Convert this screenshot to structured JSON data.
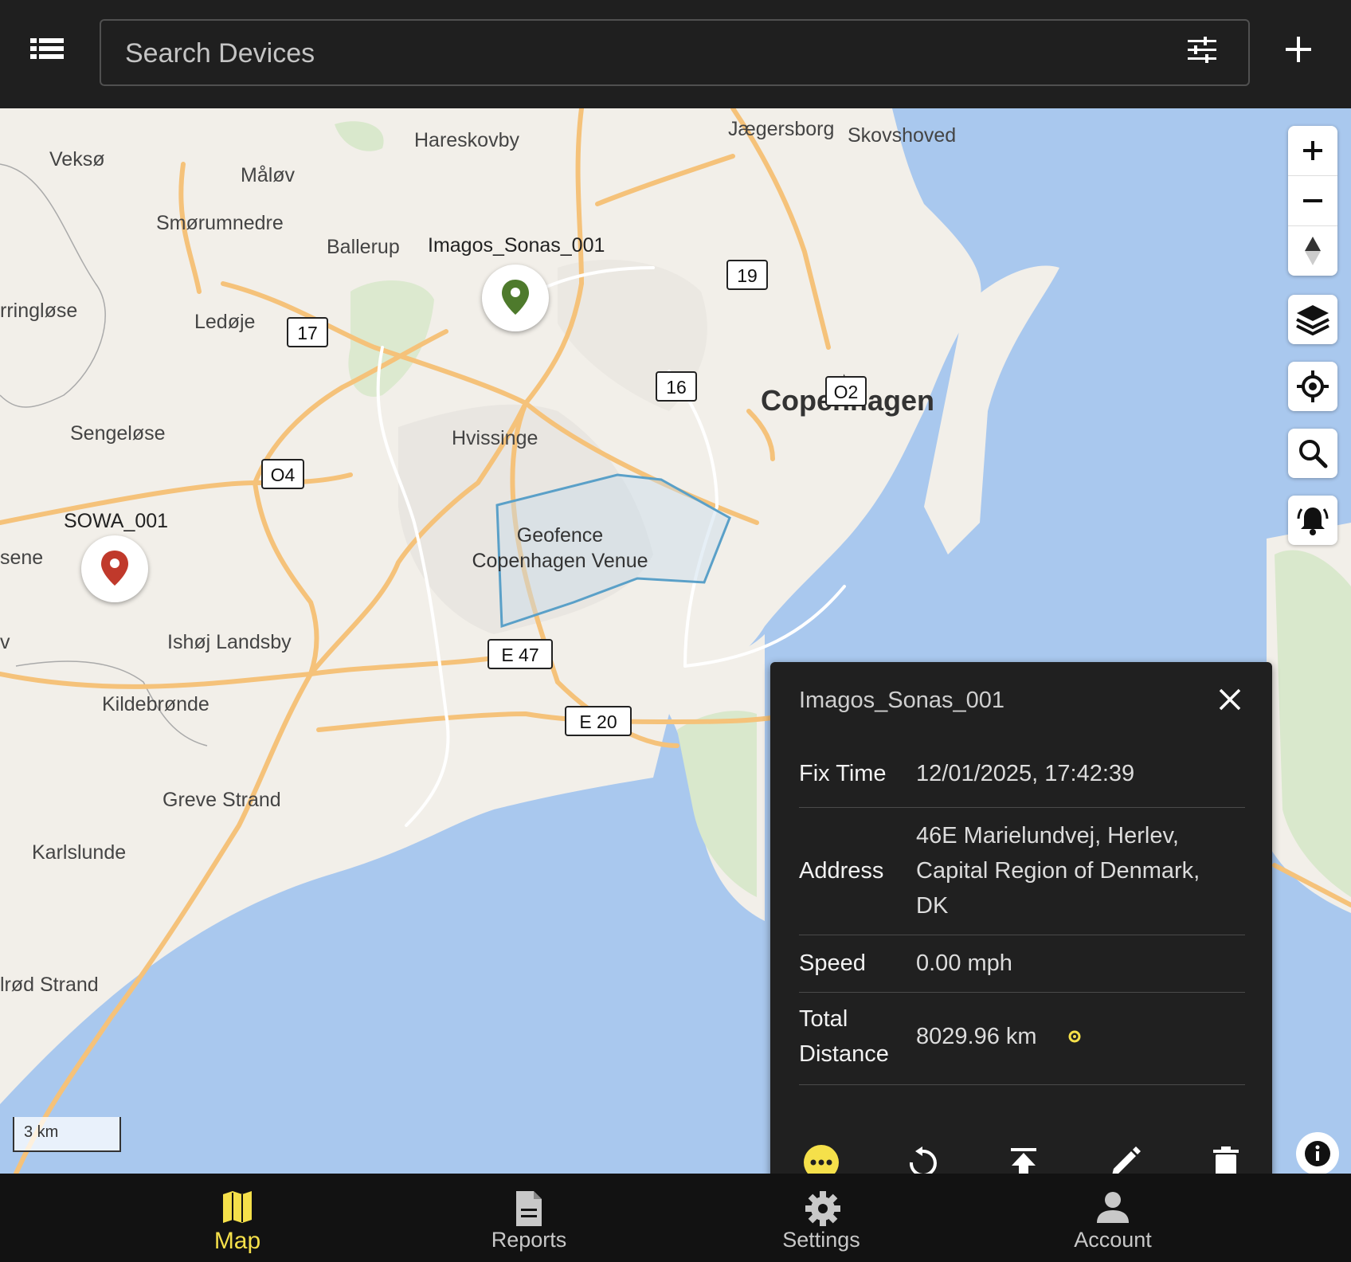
{
  "topbar": {
    "search_placeholder": "Search Devices",
    "menu_icon": "list-icon",
    "filter_icon": "tune-icon",
    "add_icon": "plus-icon"
  },
  "map": {
    "places": [
      "Veksø",
      "Måløv",
      "Hareskovby",
      "Jægersborg",
      "Skovshoved",
      "Smørumnedre",
      "Ballerup",
      "rringløse",
      "Ledøje",
      "Copenhagen",
      "Hvissinge",
      "Sengeløse",
      "sene",
      "Ishøj Landsby",
      "Kildebrønde",
      "Greve Strand",
      "Karlslunde",
      "lrød Strand",
      "v"
    ],
    "road_shields": [
      "19",
      "16",
      "O2",
      "17",
      "O4",
      "E 47",
      "E 20"
    ],
    "devices": [
      {
        "name": "Imagos_Sonas_001",
        "status_color": "#4e7a2c"
      },
      {
        "name": "SOWA_001",
        "status_color": "#c0392b"
      }
    ],
    "geofence": {
      "line1": "Geofence",
      "line2": "Copenhagen Venue",
      "color": "#5aa0c8"
    },
    "scale": "3 km",
    "colors": {
      "land": "#f2efe9",
      "water": "#a9c8ee",
      "road": "#f5c27a",
      "park": "#d9e8cc"
    }
  },
  "controls": [
    "zoom-in-icon",
    "zoom-out-icon",
    "compass-icon",
    "layers-icon",
    "my-location-icon",
    "search-icon",
    "alarm-bell-icon"
  ],
  "popup": {
    "title": "Imagos_Sonas_001",
    "rows": [
      {
        "label": "Fix Time",
        "value": "12/01/2025, 17:42:39"
      },
      {
        "label": "Address",
        "value_lines": [
          "46E Marielundvej, Herlev,",
          "Capital Region of Denmark,",
          "DK"
        ]
      },
      {
        "label": "Speed",
        "value": "0.00 mph"
      },
      {
        "label_lines": [
          "Total",
          "Distance"
        ],
        "value": "8029.96 km"
      }
    ],
    "accent": "#f5e04a"
  },
  "nav": [
    {
      "label": "Map",
      "icon": "map-icon",
      "active": true
    },
    {
      "label": "Reports",
      "icon": "document-icon",
      "active": false
    },
    {
      "label": "Settings",
      "icon": "gear-icon",
      "active": false
    },
    {
      "label": "Account",
      "icon": "person-icon",
      "active": false
    }
  ]
}
